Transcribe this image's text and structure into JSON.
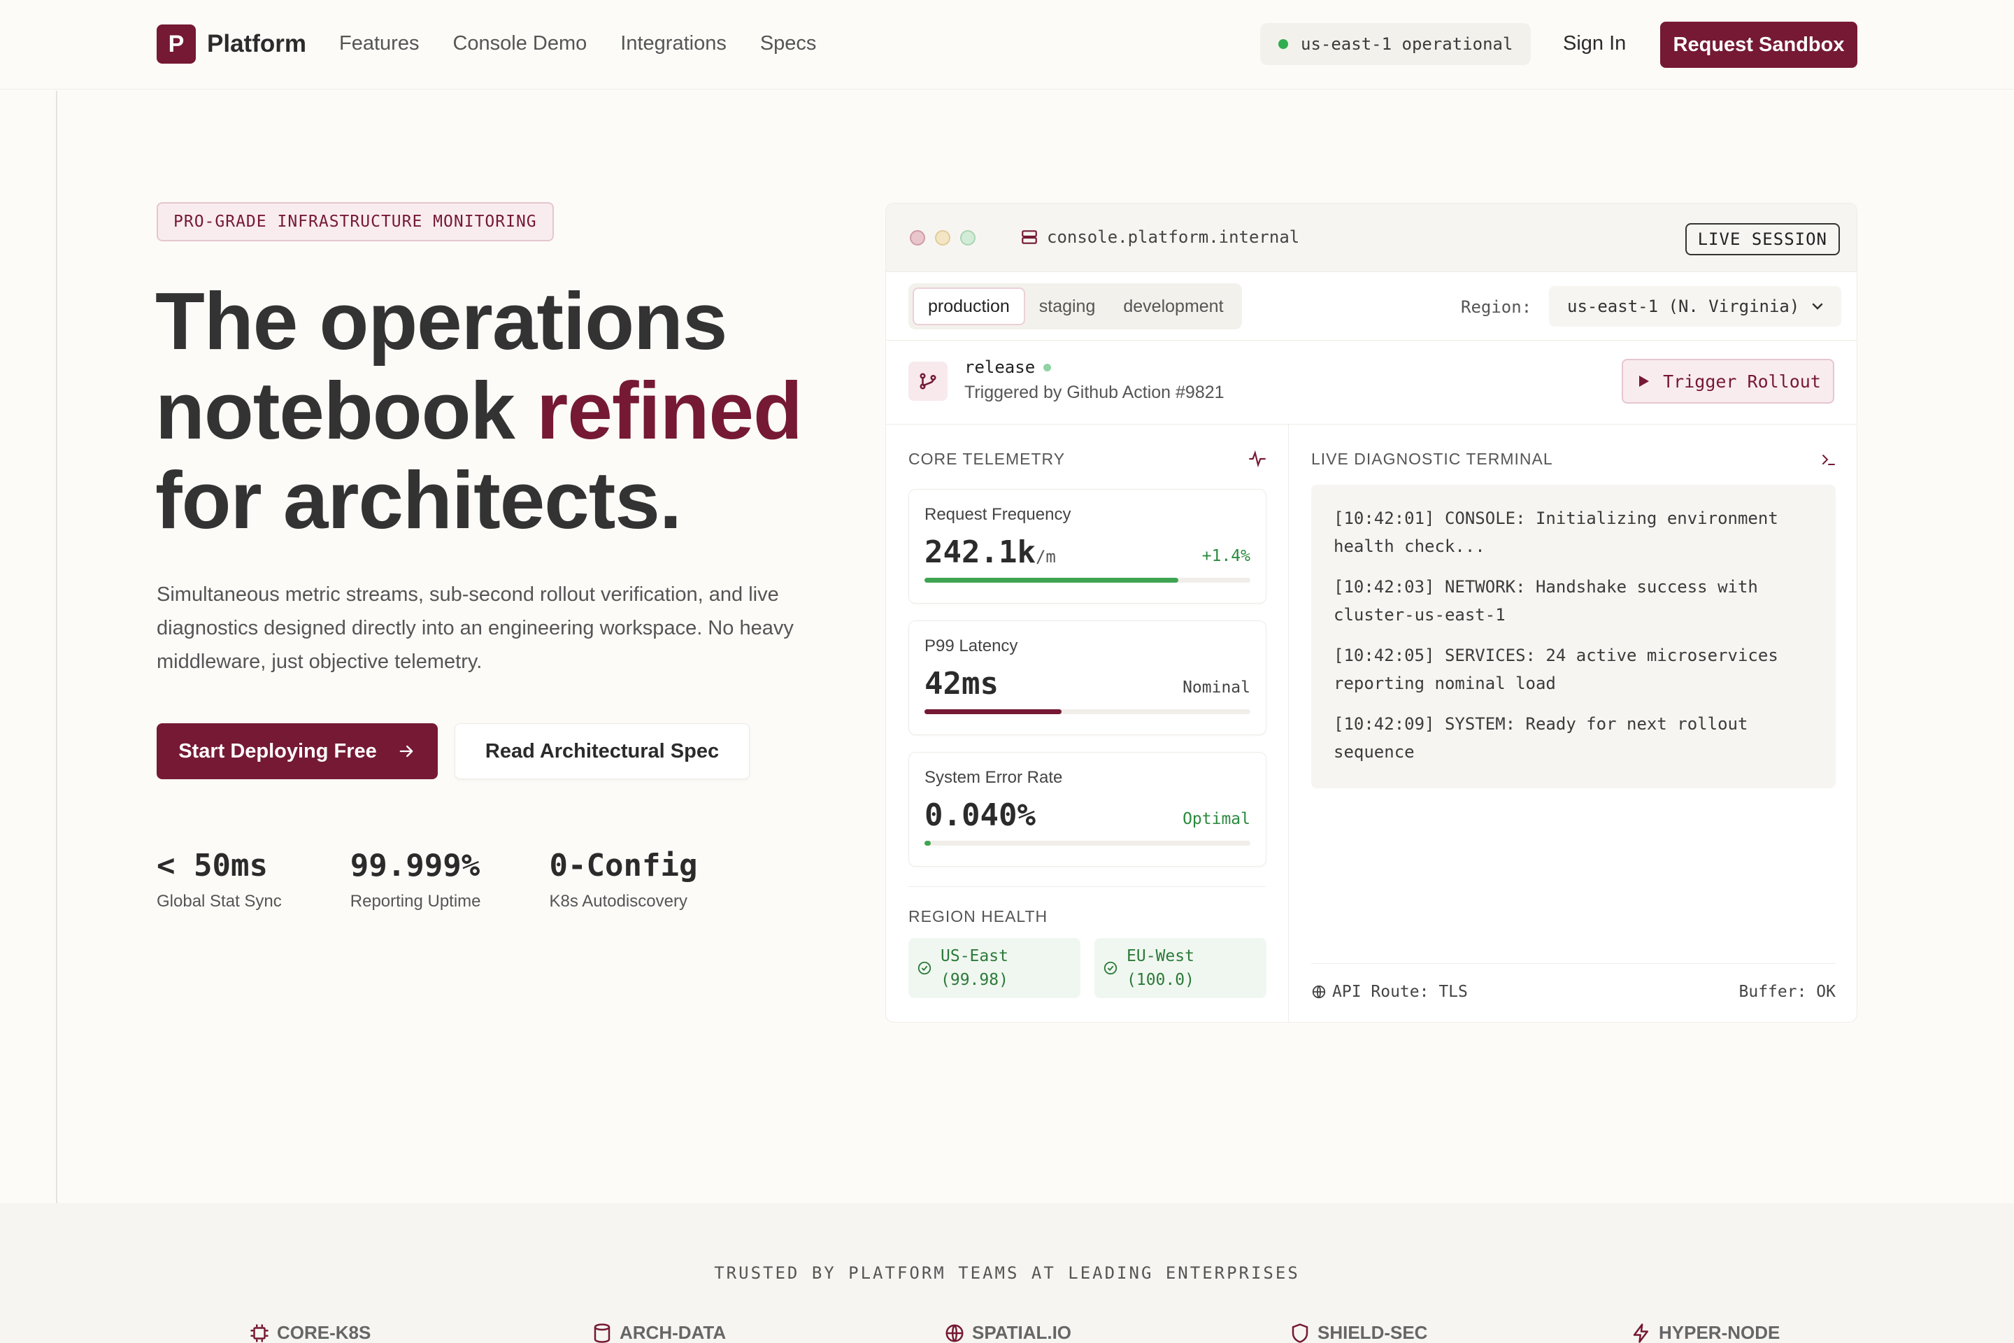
{
  "nav": {
    "brand_mark": "P",
    "brand_name": "Platform",
    "links": [
      "Features",
      "Console Demo",
      "Integrations",
      "Specs"
    ],
    "status": "us-east-1 operational",
    "sign_in": "Sign In",
    "request_sandbox": "Request Sandbox"
  },
  "hero": {
    "badge": "PRO-GRADE INFRASTRUCTURE MONITORING",
    "headline_line1": "The operations",
    "headline_line2_a": "notebook ",
    "headline_line2_b": "refined",
    "headline_line3": "for architects.",
    "lede": "Simultaneous metric streams, sub-second rollout verification, and live diagnostics designed directly into an engineering workspace. No heavy middleware, just objective telemetry.",
    "cta_primary": "Start Deploying Free",
    "cta_secondary": "Read Architectural Spec",
    "stats": [
      {
        "value": "< 50ms",
        "label": "Global Stat Sync"
      },
      {
        "value": "99.999%",
        "label": "Reporting Uptime"
      },
      {
        "value": "0-Config",
        "label": "K8s Autodiscovery"
      }
    ]
  },
  "console": {
    "url": "console.platform.internal",
    "live_badge": "LIVE SESSION",
    "env_tabs": [
      "production",
      "staging",
      "development"
    ],
    "active_env": "production",
    "region_label": "Region:",
    "region_value": "us-east-1 (N. Virginia)",
    "release_title": "release",
    "release_sub": "Triggered by Github Action #9821",
    "trigger_label": "Trigger Rollout",
    "telemetry_title": "CORE TELEMETRY",
    "metrics": [
      {
        "label": "Request Frequency",
        "value": "242.1k",
        "unit": "/m",
        "tag": "+1.4%",
        "progress": 0.78
      },
      {
        "label": "P99 Latency",
        "value": "42ms",
        "unit": "",
        "tag": "Nominal",
        "progress": 0.42
      },
      {
        "label": "System Error Rate",
        "value": "0.040%",
        "unit": "",
        "tag": "Optimal",
        "progress": 0.02
      }
    ],
    "region_health_title": "REGION HEALTH",
    "regions": [
      {
        "name": "US-East",
        "value": "(99.98)"
      },
      {
        "name": "EU-West",
        "value": "(100.0)"
      }
    ],
    "terminal_title": "LIVE DIAGNOSTIC TERMINAL",
    "terminal_lines": [
      "[10:42:01] CONSOLE: Initializing environment health check...",
      "[10:42:03] NETWORK: Handshake success with cluster-us-east-1",
      "[10:42:05] SERVICES: 24 active microservices reporting nominal load",
      "[10:42:09] SYSTEM: Ready for next rollout sequence"
    ],
    "api_route": "API Route: TLS",
    "buffer": "Buffer: OK"
  },
  "trusted": {
    "title": "TRUSTED BY PLATFORM TEAMS AT LEADING ENTERPRISES",
    "logos": [
      "CORE-K8S",
      "ARCH-DATA",
      "SPATIAL.IO",
      "SHIELD-SEC",
      "HYPER-NODE"
    ]
  },
  "colors": {
    "brand": "#751934",
    "background": "#fcfbf8",
    "success": "#2fae4f"
  }
}
